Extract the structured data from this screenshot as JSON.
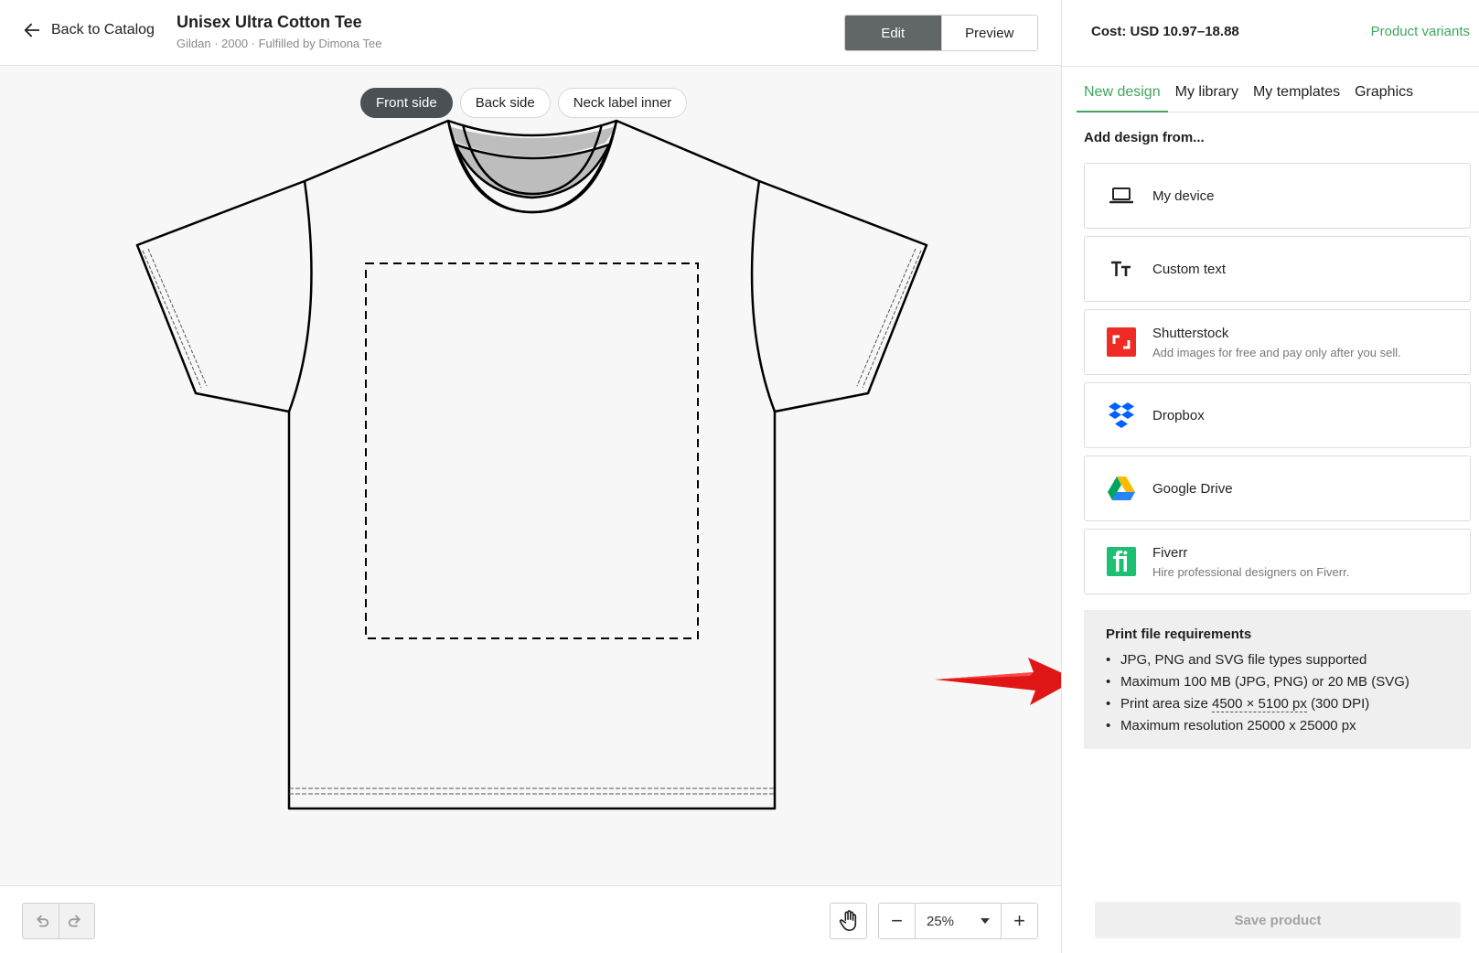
{
  "header": {
    "back_label": "Back to Catalog",
    "product_title": "Unisex Ultra Cotton Tee",
    "product_subtitle": "Gildan · 2000 · Fulfilled by Dimona Tee",
    "edit_label": "Edit",
    "preview_label": "Preview"
  },
  "side_tabs": [
    {
      "label": "Front side",
      "active": true
    },
    {
      "label": "Back side",
      "active": false
    },
    {
      "label": "Neck label inner",
      "active": false
    }
  ],
  "toolbar": {
    "zoom_value": "25%",
    "zoom_minus": "−",
    "zoom_plus": "+"
  },
  "panel": {
    "cost": "Cost: USD 10.97–18.88",
    "variants_link": "Product variants",
    "tabs": [
      {
        "label": "New design",
        "active": true
      },
      {
        "label": "My library",
        "active": false
      },
      {
        "label": "My templates",
        "active": false
      },
      {
        "label": "Graphics",
        "active": false
      }
    ],
    "add_design_label": "Add design from...",
    "sources": [
      {
        "name": "My device",
        "desc": "",
        "icon": "laptop-icon"
      },
      {
        "name": "Custom text",
        "desc": "",
        "icon": "text-icon"
      },
      {
        "name": "Shutterstock",
        "desc": "Add images for free and pay only after you sell.",
        "icon": "shutterstock-icon"
      },
      {
        "name": "Dropbox",
        "desc": "",
        "icon": "dropbox-icon"
      },
      {
        "name": "Google Drive",
        "desc": "",
        "icon": "google-drive-icon"
      },
      {
        "name": "Fiverr",
        "desc": "Hire professional designers on Fiverr.",
        "icon": "fiverr-icon"
      }
    ],
    "requirements": {
      "title": "Print file requirements",
      "items": [
        "JPG, PNG and SVG file types supported",
        "Maximum 100 MB (JPG, PNG) or 20 MB (SVG)"
      ],
      "size_prefix": "Print area size",
      "size_value": "4500 × 5100 px",
      "size_suffix": "(300 DPI)",
      "resolution": "Maximum resolution 25000 x 25000 px"
    },
    "save_label": "Save product"
  },
  "colors": {
    "accent_green": "#3fa55c",
    "edit_active": "#616669",
    "arrow_red": "#e01616"
  }
}
